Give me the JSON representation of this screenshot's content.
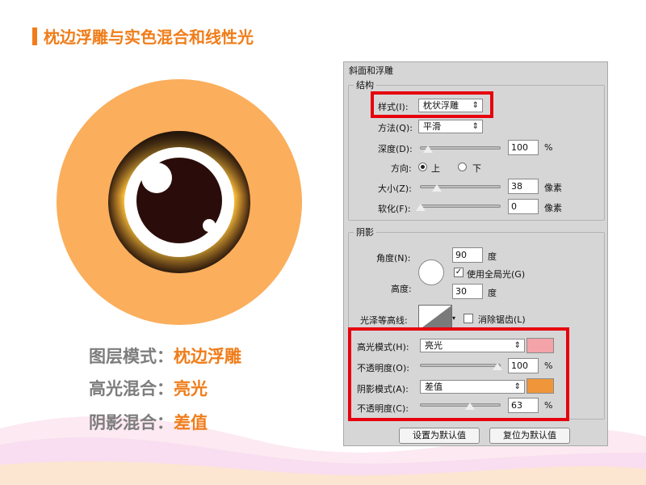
{
  "slide": {
    "title": "枕边浮雕与实色混合和线性光",
    "info": [
      {
        "label": "图层模式：",
        "value": "枕边浮雕"
      },
      {
        "label": "高光混合：",
        "value": "亮光"
      },
      {
        "label": "阴影混合：",
        "value": "差值"
      }
    ]
  },
  "panel": {
    "header": "斜面和浮雕",
    "structure": {
      "title": "结构",
      "style_label": "样式(I):",
      "style_value": "枕状浮雕",
      "technique_label": "方法(Q):",
      "technique_value": "平滑",
      "depth_label": "深度(D):",
      "depth_value": "100",
      "depth_unit": "%",
      "direction_label": "方向:",
      "direction_up": "上",
      "direction_down": "下",
      "size_label": "大小(Z):",
      "size_value": "38",
      "size_unit": "像素",
      "soften_label": "软化(F):",
      "soften_value": "0",
      "soften_unit": "像素"
    },
    "shading": {
      "title": "阴影",
      "angle_label": "角度(N):",
      "angle_value": "90",
      "angle_unit": "度",
      "global_light_label": "使用全局光(G)",
      "altitude_label": "高度:",
      "altitude_value": "30",
      "altitude_unit": "度",
      "gloss_label": "光泽等高线:",
      "antialias_label": "消除锯齿(L)",
      "highlight_mode_label": "高光模式(H):",
      "highlight_mode_value": "亮光",
      "highlight_color": "#f4a3a8",
      "highlight_opacity_label": "不透明度(O):",
      "highlight_opacity_value": "100",
      "highlight_opacity_unit": "%",
      "shadow_mode_label": "阴影模式(A):",
      "shadow_mode_value": "差值",
      "shadow_color": "#f0963a",
      "shadow_opacity_label": "不透明度(C):",
      "shadow_opacity_value": "63",
      "shadow_opacity_unit": "%"
    },
    "buttons": {
      "set_default": "设置为默认值",
      "reset_default": "复位为默认值"
    }
  },
  "colors": {
    "accent": "#f07d1a",
    "label_gray": "#7d7d7d",
    "highlight_box": "#e6000e"
  }
}
